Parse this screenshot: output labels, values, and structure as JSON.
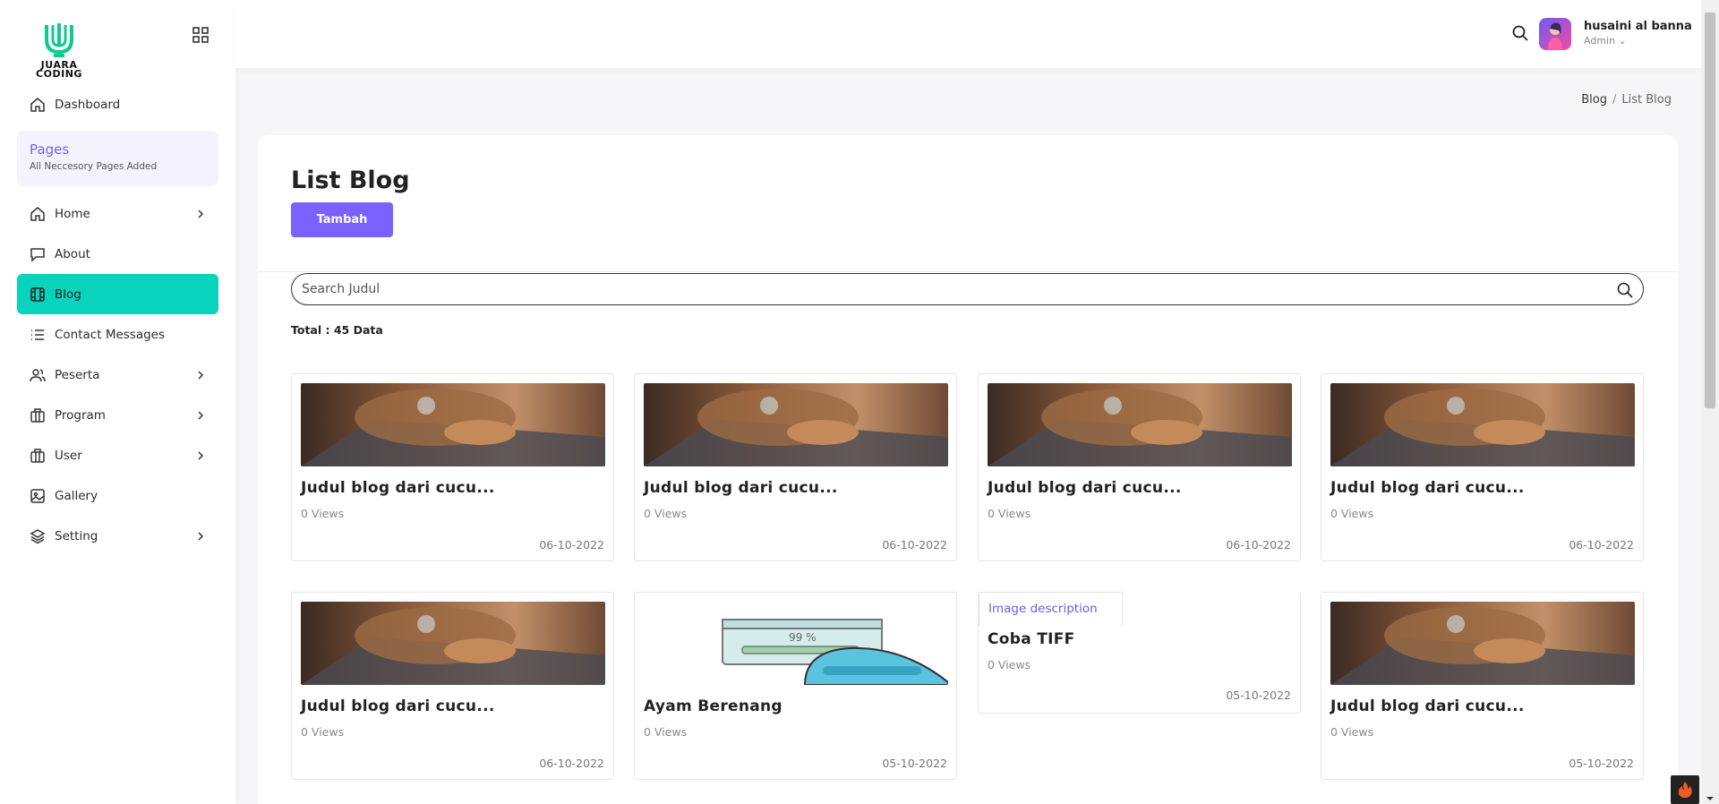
{
  "brand": {
    "name_line1": "JUARA",
    "name_line2": "CODING"
  },
  "sidebar": {
    "dashboard": "Dashboard",
    "pages_title": "Pages",
    "pages_subtitle": "All Neccesory Pages Added",
    "items": [
      {
        "label": "Home",
        "icon": "home-icon",
        "has_children": true
      },
      {
        "label": "About",
        "icon": "chat-icon",
        "has_children": false
      },
      {
        "label": "Blog",
        "icon": "film-icon",
        "has_children": false,
        "active": true
      },
      {
        "label": "Contact Messages",
        "icon": "list-icon",
        "has_children": false
      },
      {
        "label": "Peserta",
        "icon": "users-icon",
        "has_children": true
      },
      {
        "label": "Program",
        "icon": "briefcase-icon",
        "has_children": true
      },
      {
        "label": "User",
        "icon": "briefcase-icon",
        "has_children": true
      },
      {
        "label": "Gallery",
        "icon": "image-icon",
        "has_children": false
      },
      {
        "label": "Setting",
        "icon": "layers-icon",
        "has_children": true
      }
    ],
    "active_color": "#08d4bd"
  },
  "header": {
    "user_name": "husaini al banna",
    "user_role": "Admin ⌄"
  },
  "breadcrumb": {
    "parent": "Blog",
    "separator": "/",
    "current": "List Blog"
  },
  "main": {
    "title": "List Blog",
    "add_button": "Tambah",
    "search_placeholder": "Search Judul",
    "total_text": "Total : 45 Data",
    "accent": "#7b61ff"
  },
  "blogs": [
    {
      "title": "Judul blog dari cucu...",
      "views": "0 Views",
      "date": "06-10-2022",
      "image": "cat-laptop"
    },
    {
      "title": "Judul blog dari cucu...",
      "views": "0 Views",
      "date": "06-10-2022",
      "image": "cat-laptop"
    },
    {
      "title": "Judul blog dari cucu...",
      "views": "0 Views",
      "date": "06-10-2022",
      "image": "cat-laptop"
    },
    {
      "title": "Judul blog dari cucu...",
      "views": "0 Views",
      "date": "06-10-2022",
      "image": "cat-laptop"
    },
    {
      "title": "Judul blog dari cucu...",
      "views": "0 Views",
      "date": "06-10-2022",
      "image": "cat-laptop"
    },
    {
      "title": "Ayam Berenang",
      "views": "0 Views",
      "date": "05-10-2022",
      "image": "cartoon-illustration",
      "image_text": "99 %"
    },
    {
      "title": "Coba TIFF",
      "views": "0 Views",
      "date": "05-10-2022",
      "image": "broken",
      "image_alt": "Image description"
    },
    {
      "title": "Judul blog dari cucu...",
      "views": "0 Views",
      "date": "05-10-2022",
      "image": "cat-laptop"
    }
  ]
}
